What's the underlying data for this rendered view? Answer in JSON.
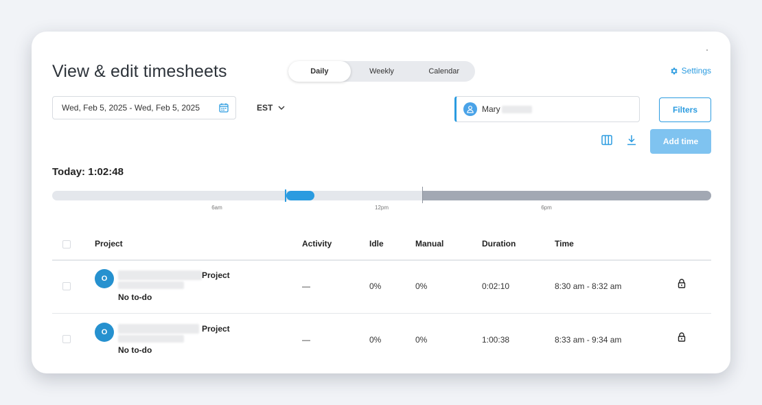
{
  "header": {
    "title": "View & edit timesheets",
    "settings_label": "Settings"
  },
  "view_tabs": [
    {
      "label": "Daily",
      "active": true
    },
    {
      "label": "Weekly",
      "active": false
    },
    {
      "label": "Calendar",
      "active": false
    }
  ],
  "date_range": "Wed, Feb 5, 2025 - Wed, Feb 5, 2025",
  "timezone": "EST",
  "member": {
    "name": "Mary"
  },
  "buttons": {
    "filters": "Filters",
    "add_time": "Add time"
  },
  "today": {
    "label": "Today: 1:02:48"
  },
  "timeline": {
    "ticks": [
      "6am",
      "12pm",
      "6pm"
    ]
  },
  "table": {
    "columns": [
      "Project",
      "Activity",
      "Idle",
      "Manual",
      "Duration",
      "Time"
    ],
    "rows": [
      {
        "avatar": "O",
        "project": "Project",
        "todo": "No to-do",
        "activity": "—",
        "idle": "0%",
        "manual": "0%",
        "duration": "0:02:10",
        "time": "8:30 am - 8:32 am"
      },
      {
        "avatar": "O",
        "project": "Project",
        "todo": "No to-do",
        "activity": "—",
        "idle": "0%",
        "manual": "0%",
        "duration": "1:00:38",
        "time": "8:33 am - 9:34 am"
      }
    ]
  },
  "colors": {
    "accent": "#2a9be0",
    "add_time_bg": "#7fc3f0",
    "future_bar": "#a2a8b3",
    "track": "#e4e7ec"
  },
  "icons": [
    "gear-icon",
    "calendar-icon",
    "chevron-down-icon",
    "user-icon",
    "columns-icon",
    "download-icon",
    "lock-icon"
  ]
}
